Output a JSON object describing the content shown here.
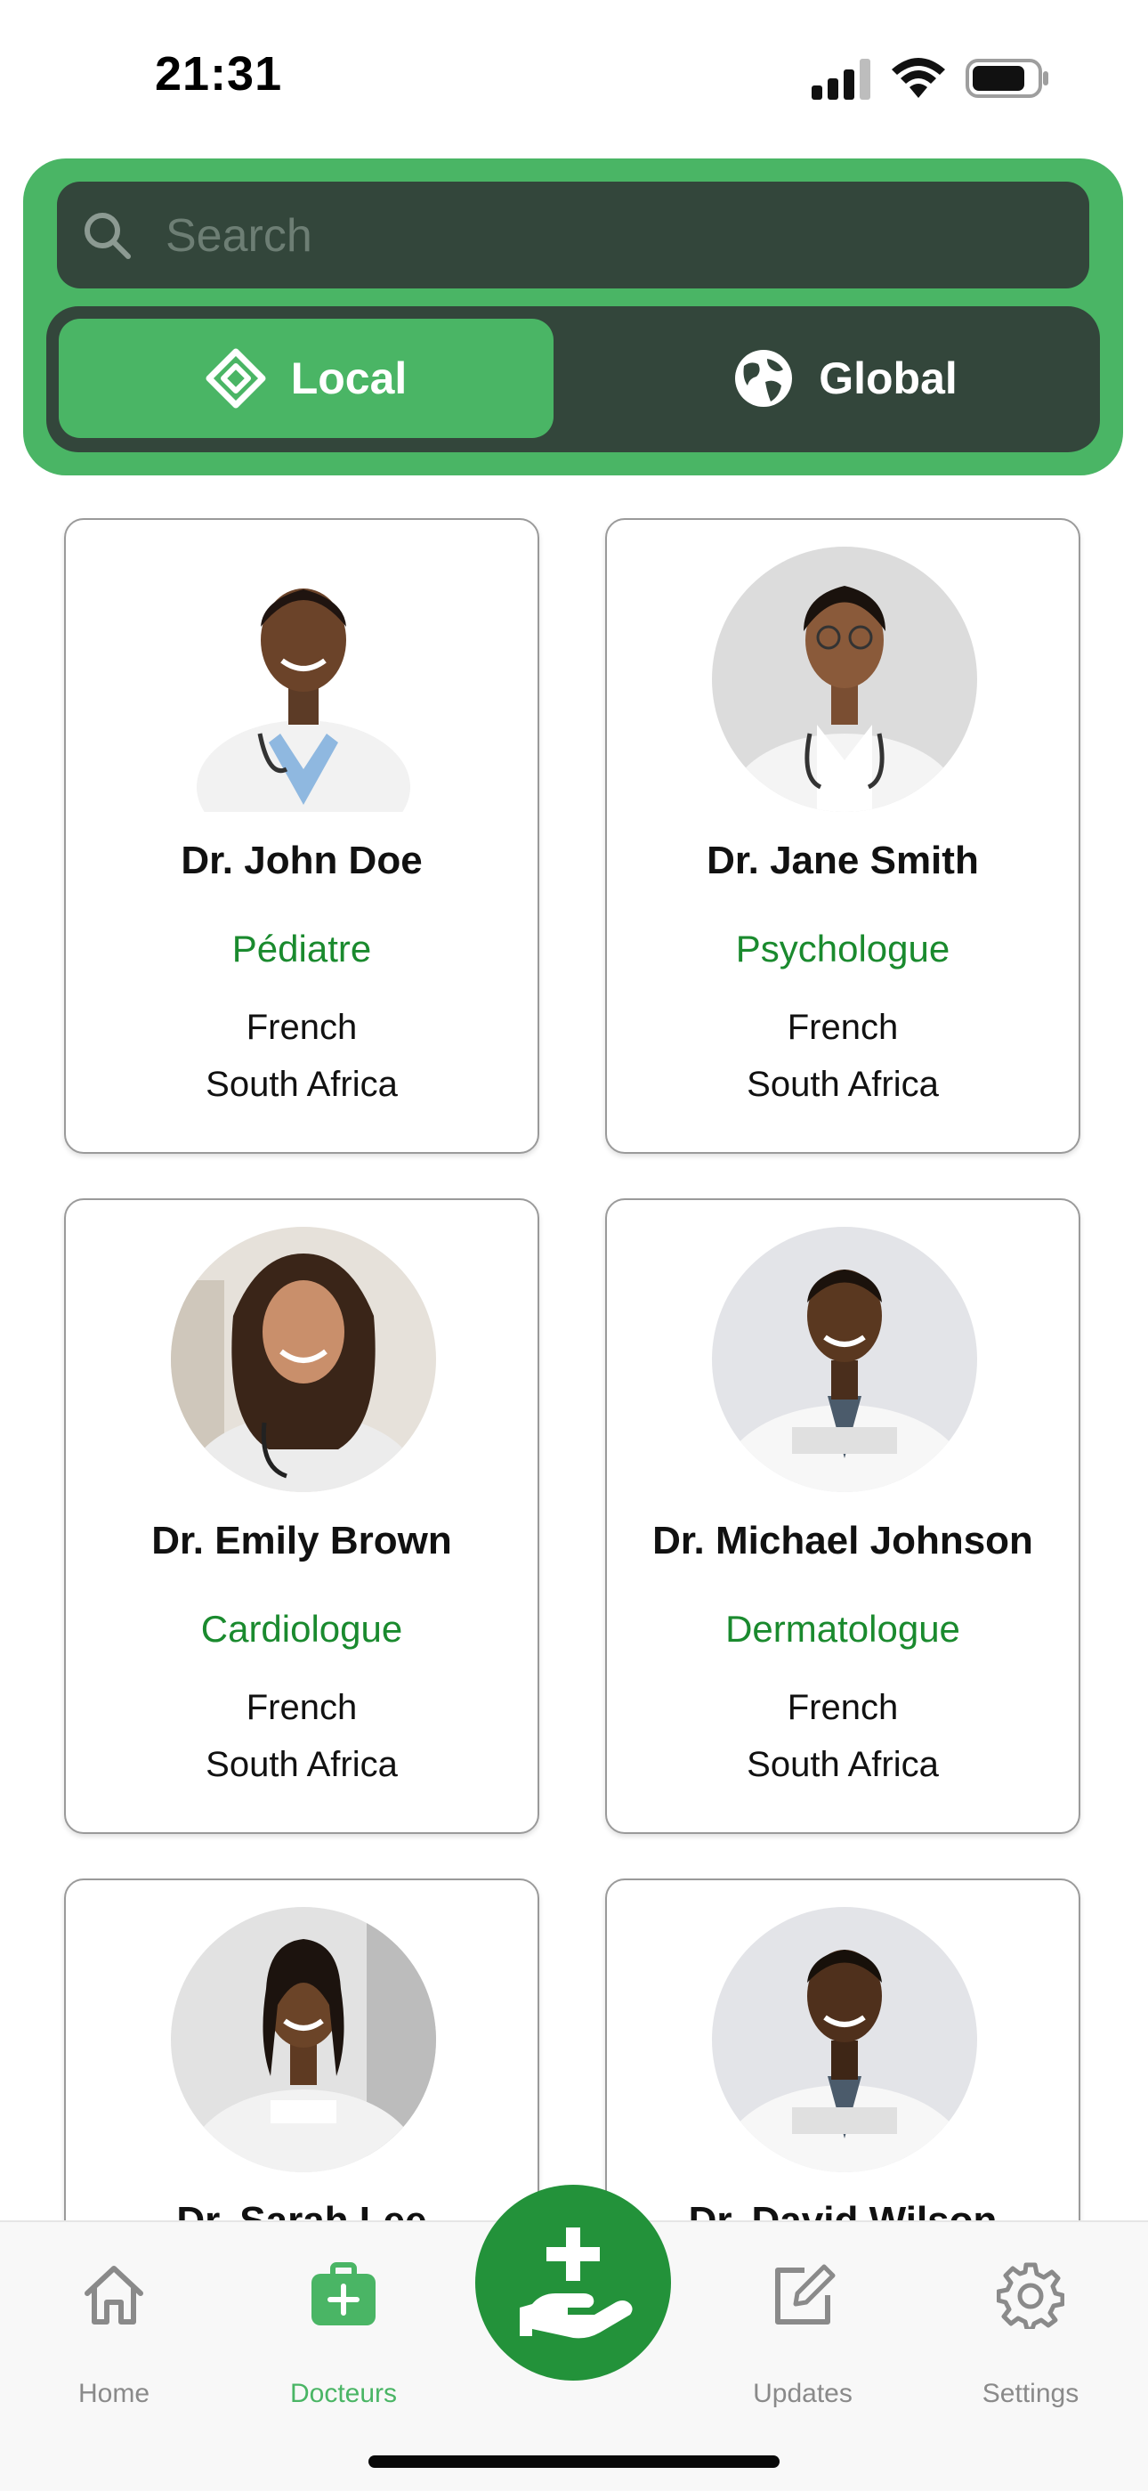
{
  "status_bar": {
    "time": "21:31",
    "icons": [
      "cellular-signal-icon",
      "wifi-icon",
      "battery-icon"
    ]
  },
  "search": {
    "placeholder": "Search",
    "value": ""
  },
  "scope_toggle": {
    "options": [
      {
        "label": "Local",
        "icon": "diamond-icon",
        "selected": true
      },
      {
        "label": "Global",
        "icon": "globe-icon",
        "selected": false
      }
    ]
  },
  "doctors": [
    {
      "name": "Dr. John Doe",
      "specialty": "Pédiatre",
      "language": "French",
      "country": "South Africa"
    },
    {
      "name": "Dr. Jane Smith",
      "specialty": "Psychologue",
      "language": "French",
      "country": "South Africa"
    },
    {
      "name": "Dr. Emily Brown",
      "specialty": "Cardiologue",
      "language": "French",
      "country": "South Africa"
    },
    {
      "name": "Dr. Michael Johnson",
      "specialty": "Dermatologue",
      "language": "French",
      "country": "South Africa"
    },
    {
      "name": "Dr. Sarah Lee",
      "specialty": "",
      "language": "",
      "country": ""
    },
    {
      "name": "Dr. David Wilson",
      "specialty": "",
      "language": "",
      "country": ""
    }
  ],
  "tab_bar": {
    "items": [
      {
        "label": "Home",
        "icon": "home-icon",
        "active": false
      },
      {
        "label": "Docteurs",
        "icon": "medical-kit-icon",
        "active": true
      },
      {
        "label": "",
        "icon": "hand-plus-icon",
        "active": false
      },
      {
        "label": "Updates",
        "icon": "edit-icon",
        "active": false
      },
      {
        "label": "Settings",
        "icon": "gear-icon",
        "active": false
      }
    ]
  },
  "colors": {
    "accent_green": "#4ab565",
    "dark_green": "#33463b",
    "specialty_green": "#1a8a2e",
    "fab_green": "#23923a"
  }
}
